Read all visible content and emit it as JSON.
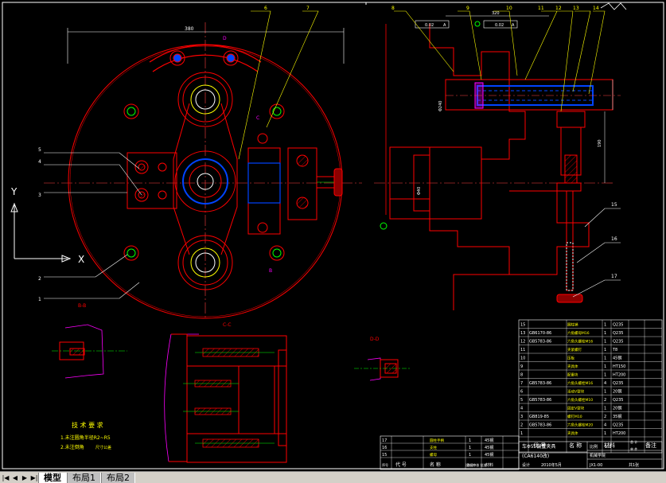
{
  "layout_tabs": [
    "模型",
    "布局1",
    "布局2"
  ],
  "active_tab": 0,
  "ucs": {
    "x_label": "X",
    "y_label": "Y"
  },
  "front_view": {
    "width_dim": "380",
    "section_mark_d": "D",
    "section_mark_c": "C",
    "section_mark_b": "B",
    "leaders_left": [
      "5",
      "4",
      "3",
      "2",
      "1"
    ],
    "leaders_top": [
      "6",
      "7"
    ]
  },
  "side_view": {
    "leaders_top": [
      "8",
      "9",
      "10",
      "11",
      "12",
      "13",
      "14"
    ],
    "leaders_right": [
      "15",
      "16",
      "17"
    ],
    "dim_top": "320",
    "tol_frame_1": "0.02",
    "tol_frame_2": "0.02",
    "datum": "A",
    "dim_right": "190",
    "dim_left": "Φ240",
    "dim_bore": "Φ40"
  },
  "section_labels": {
    "bb": "B-B",
    "cc": "C-C",
    "dd": "D-D"
  },
  "tech_req": {
    "title": "技 术 要 求",
    "lines": [
      "1.未注圆角半径R2~R5",
      "2.未注倒角",
      "尺寸公差"
    ]
  },
  "bom": {
    "rows": [
      {
        "no": "15",
        "code": "",
        "name": "圆柱销",
        "qty": "1",
        "material": "Q235"
      },
      {
        "no": "13",
        "code": "GB6170-86",
        "name": "六角螺母M16",
        "qty": "1",
        "material": "Q235"
      },
      {
        "no": "12",
        "code": "GB5783-86",
        "name": "六角头螺栓M16",
        "qty": "1",
        "material": "Q235"
      },
      {
        "no": "11",
        "code": "",
        "name": "夹紧螺钉",
        "qty": "1",
        "material": "T8"
      },
      {
        "no": "10",
        "code": "",
        "name": "压板",
        "qty": "1",
        "material": "45钢"
      },
      {
        "no": "9",
        "code": "",
        "name": "夹具体",
        "qty": "1",
        "material": "HT150"
      },
      {
        "no": "8",
        "code": "",
        "name": "配重块",
        "qty": "1",
        "material": "HT200"
      },
      {
        "no": "7",
        "code": "GB5783-86",
        "name": "六角头螺栓M16",
        "qty": "4",
        "material": "Q235"
      },
      {
        "no": "6",
        "code": "",
        "name": "活动V型块",
        "qty": "1",
        "material": "20钢"
      },
      {
        "no": "5",
        "code": "GB5783-86",
        "name": "六角头螺栓M10",
        "qty": "2",
        "material": "Q235"
      },
      {
        "no": "4",
        "code": "",
        "name": "固定V型块",
        "qty": "1",
        "material": "20钢"
      },
      {
        "no": "3",
        "code": "GB819-85",
        "name": "螺钉M10",
        "qty": "2",
        "material": "35钢"
      },
      {
        "no": "2",
        "code": "GB5783-86",
        "name": "六角头螺栓M20",
        "qty": "4",
        "material": "Q235"
      },
      {
        "no": "1",
        "code": "",
        "name": "夹具体",
        "qty": "1",
        "material": "HT200"
      }
    ],
    "header": {
      "col_code": "代 号",
      "col_name": "名 称",
      "col_material": "材料",
      "col_note": "备注"
    },
    "header_extra": [
      "总 计",
      "单 件"
    ],
    "left_rows": [
      {
        "no": "17",
        "name": "圆柱手柄",
        "qty": "1",
        "material": "45钢"
      },
      {
        "no": "16",
        "name": "支柱",
        "qty": "1",
        "material": "45钢"
      },
      {
        "no": "15",
        "name": "螺母",
        "qty": "1",
        "material": "45钢"
      }
    ],
    "left_header": {
      "no": "序号",
      "code": "代 号",
      "name": "名 称",
      "qty": "数量",
      "material": "材料"
    }
  },
  "title_block": {
    "part_name": "车Φ55偏置夹具",
    "machine": "(CA6140改)",
    "scale_label": "比例",
    "scale": "1:1",
    "school": "机械学院",
    "designer_label": "设计",
    "date": "2010年5月",
    "drawing_no": "JX1-00",
    "sheet": "共1张",
    "footer": "设计 审核 批准"
  }
}
